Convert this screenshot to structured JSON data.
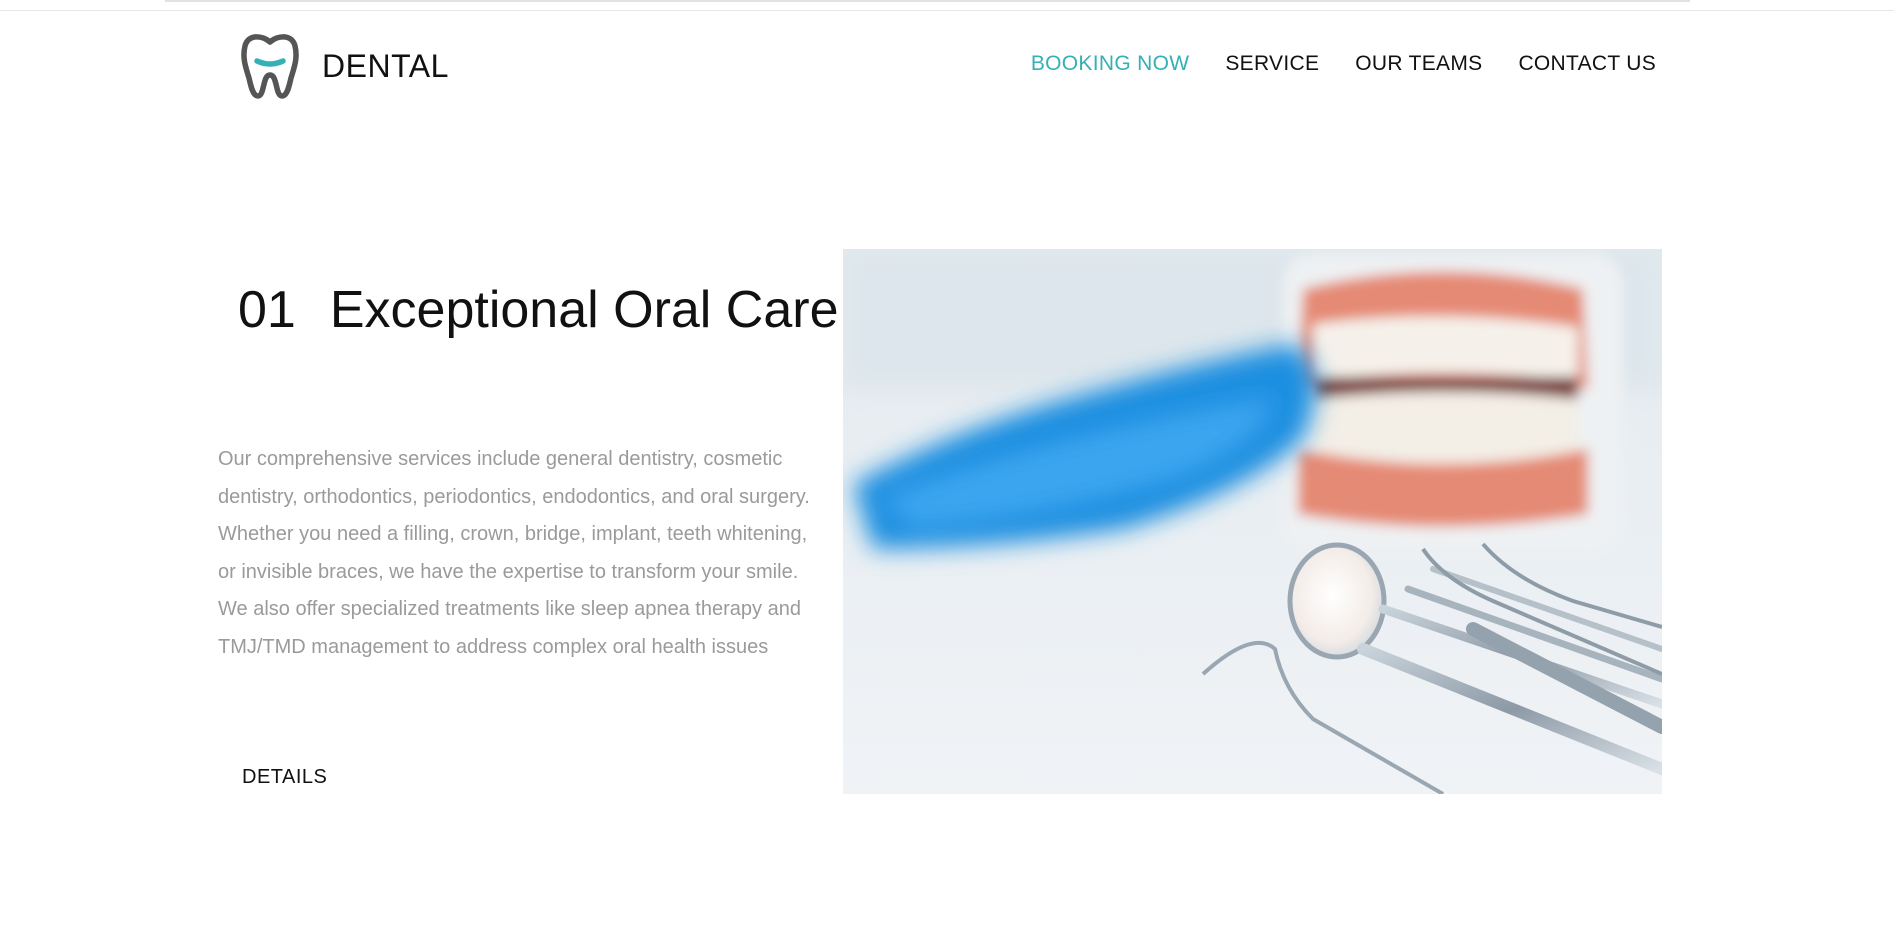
{
  "brand": {
    "name": "DENTAL",
    "logo_icon": "tooth-icon",
    "accent_color": "#35b0b6"
  },
  "nav": {
    "items": [
      {
        "label": "BOOKING NOW",
        "active": true
      },
      {
        "label": "SERVICE",
        "active": false
      },
      {
        "label": "OUR TEAMS",
        "active": false
      },
      {
        "label": "CONTACT US",
        "active": false
      }
    ]
  },
  "section": {
    "number": "01",
    "title": "Exceptional Oral Care",
    "body": "Our comprehensive services include general dentistry, cosmetic dentistry, orthodontics, periodontics, endodontics, and oral surgery. Whether you need a filling, crown, bridge, implant, teeth whitening, or invisible braces, we have the expertise to transform your smile. We also offer specialized treatments like sleep apnea therapy and TMJ/TMD management to address complex oral health issues",
    "button_label": "DETAILS",
    "image_icon": "dental-tools-photo"
  }
}
